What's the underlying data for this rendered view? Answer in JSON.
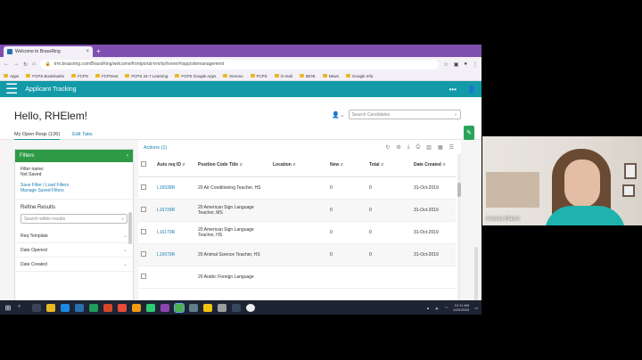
{
  "browser": {
    "tab_title": "Welcome to BrassRing",
    "url": "trm.brassring.com/BrassRing/welcome/frontportal-trm/rp/home/#/app/sitemanagement",
    "bookmarks": [
      "Apps",
      "FCPS Bookmarks",
      "FCPS",
      "FCPSnet",
      "FCPS 24-7 Learning",
      "FCPS Google Apps",
      "Kimono",
      "FCPS",
      "G-mail",
      "IBOE",
      "News",
      "Google Info"
    ]
  },
  "app": {
    "title": "Applicant Tracking",
    "greeting": "Hello, RHElem!",
    "search_placeholder": "Search Candidates",
    "tabs": [
      "My Open Reqs (126)",
      "Edit Tabs"
    ]
  },
  "filters": {
    "header": "Filters",
    "filter_name_label": "Filter name:",
    "filter_name_value": "Not Saved",
    "save_link": "Save Filter",
    "separator": "|",
    "load_link": "Load Filters",
    "manage_link": "Manage Saved Filters",
    "refine_title": "Refine Results",
    "refine_placeholder": "Search within results",
    "sections": [
      "Req Template",
      "Date Opened",
      "Date Created"
    ]
  },
  "results": {
    "actions_label": "Actions (1)",
    "columns": [
      "Auto req ID",
      "Position Code Title",
      "Location",
      "New",
      "Total",
      "Date Created"
    ],
    "rows": [
      {
        "id": "L16538R",
        "title": "20 Air Conditioning Teacher, HS",
        "location": "",
        "new": "0",
        "total": "0",
        "date": "31-Oct-2019"
      },
      {
        "id": "L16728R",
        "title": "20 American Sign Language Teacher, MS",
        "location": "",
        "new": "0",
        "total": "0",
        "date": "31-Oct-2019"
      },
      {
        "id": "L16179R",
        "title": "20 American Sign Language Teacher, HS",
        "location": "",
        "new": "0",
        "total": "0",
        "date": "31-Oct-2019"
      },
      {
        "id": "L16679R",
        "title": "20 Animal Science Teacher, HS",
        "location": "",
        "new": "0",
        "total": "0",
        "date": "31-Oct-2019"
      },
      {
        "id": "",
        "title": "20 Arabic Foreign Language",
        "location": "",
        "new": "",
        "total": "",
        "date": ""
      }
    ]
  },
  "taskbar": {
    "time": "10:11 AM",
    "date": "4/22/2020"
  },
  "webcam": {
    "participant_name": "Andrea Martin"
  },
  "colors": {
    "app_bar": "#139aa8",
    "filters_header": "#2e9a46",
    "browser_tabbar": "#7e4fb0",
    "link": "#1a7fb5"
  }
}
